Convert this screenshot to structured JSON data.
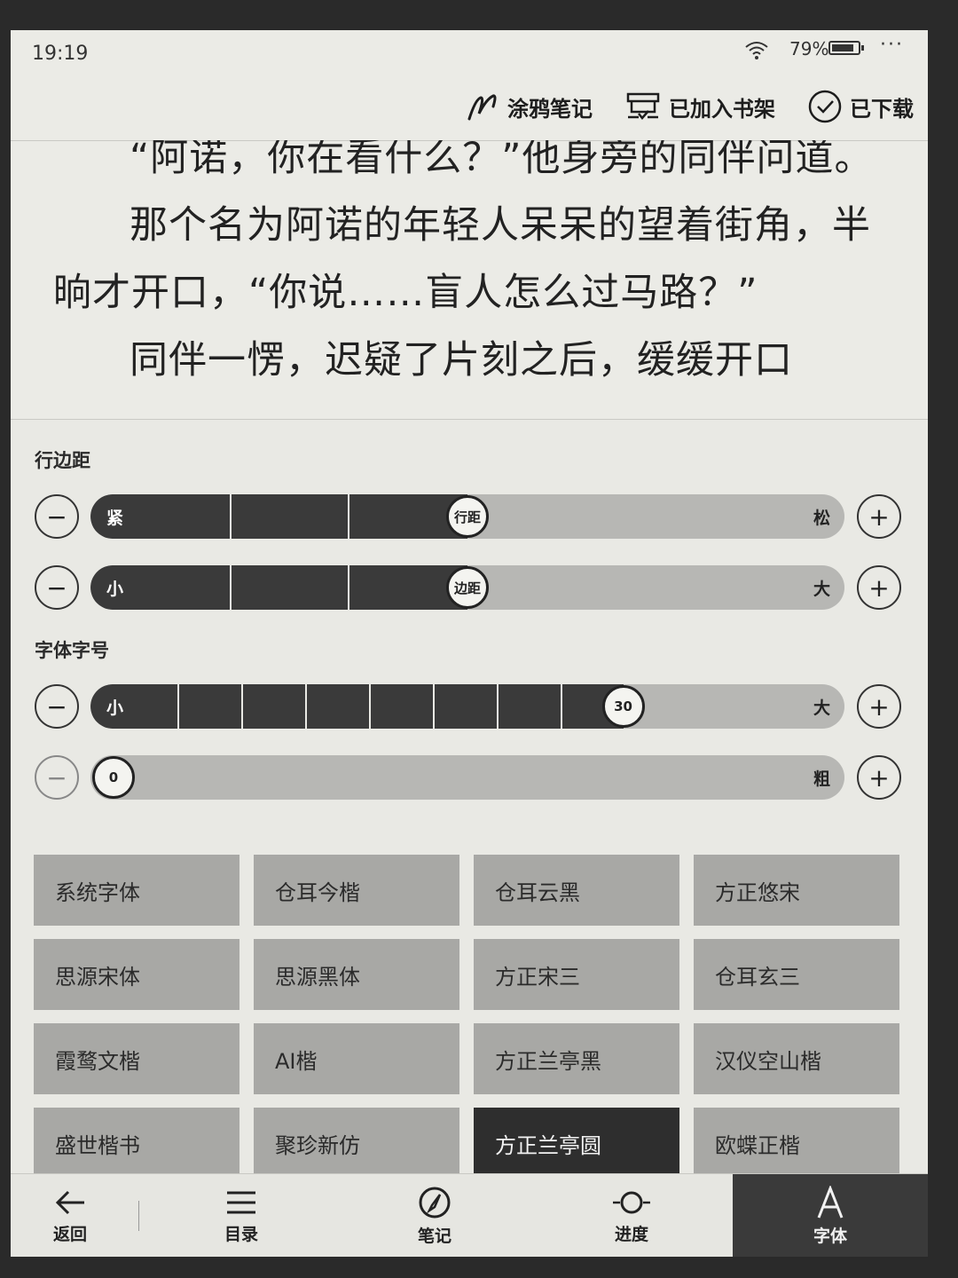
{
  "status": {
    "time": "19:19",
    "battery": "79%",
    "more": "···"
  },
  "top_actions": {
    "doodle": "涂鸦笔记",
    "shelf": "已加入书架",
    "downloaded": "已下载"
  },
  "reader": {
    "lines": [
      "“阿诺，你在看什么？”他身旁的同伴问道。",
      "那个名为阿诺的年轻人呆呆的望着街角，半晌才开口，“你说……盲人怎么过马路？”",
      "同伴一愣，迟疑了片刻之后，缓缓开口"
    ]
  },
  "panel": {
    "margin_title": "行边距",
    "line_spacing": {
      "left": "紧",
      "right": "松",
      "knob": "行距",
      "value_fraction": 0.5
    },
    "page_margin": {
      "left": "小",
      "right": "大",
      "knob": "边距",
      "value_fraction": 0.5
    },
    "font_title": "字体字号",
    "font_size": {
      "left": "小",
      "right": "大",
      "knob": "30",
      "value_fraction": 0.72
    },
    "font_weight": {
      "right": "粗",
      "knob": "0",
      "value_fraction": 0
    },
    "minus": "−",
    "plus": "+"
  },
  "fonts": [
    "系统字体",
    "仓耳今楷",
    "仓耳云黑",
    "方正悠宋",
    "思源宋体",
    "思源黑体",
    "方正宋三",
    "仓耳玄三",
    "霞鹜文楷",
    "AI楷",
    "方正兰亭黑",
    "汉仪空山楷",
    "盛世楷书",
    "聚珍新仿",
    "方正兰亭圆",
    "欧蝶正楷"
  ],
  "selected_font": "方正兰亭圆",
  "nav": {
    "back": "返回",
    "toc": "目录",
    "notes": "笔记",
    "progress": "进度",
    "font": "字体"
  }
}
